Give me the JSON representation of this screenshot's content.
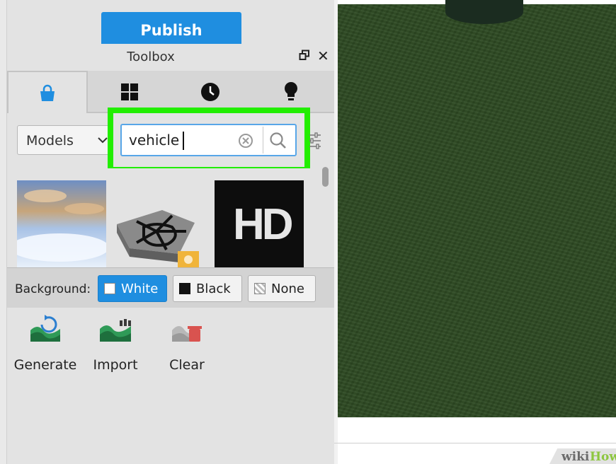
{
  "publish": {
    "label": "Publish"
  },
  "toolbox": {
    "title": "Toolbox",
    "tabs": [
      {
        "icon": "shopping-bag-icon",
        "active": true
      },
      {
        "icon": "grid-icon",
        "active": false
      },
      {
        "icon": "clock-icon",
        "active": false
      },
      {
        "icon": "lightbulb-icon",
        "active": false
      }
    ],
    "category": {
      "selected": "Models"
    },
    "search": {
      "value": "vehicle"
    },
    "highlight_color": "#22ee00",
    "results": [
      {
        "type": "sky-image"
      },
      {
        "type": "3d-model"
      },
      {
        "type": "hd-logo",
        "text": "HD"
      }
    ]
  },
  "background": {
    "label": "Background:",
    "options": [
      {
        "label": "White",
        "selected": true
      },
      {
        "label": "Black",
        "selected": false
      },
      {
        "label": "None",
        "selected": false
      }
    ]
  },
  "terrain": {
    "items": [
      {
        "label": "Generate",
        "icon": "generate-terrain-icon"
      },
      {
        "label": "Import",
        "icon": "import-terrain-icon"
      },
      {
        "label": "Clear",
        "icon": "clear-terrain-icon"
      }
    ]
  },
  "watermark": {
    "part1": "wiki",
    "part2": "How"
  },
  "colors": {
    "accent": "#1f8ee0",
    "grass": "#2e4a23"
  }
}
